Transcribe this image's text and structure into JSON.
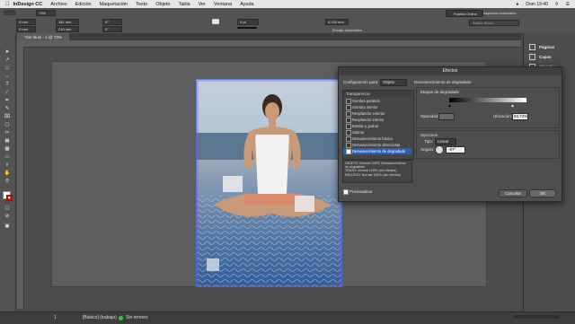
{
  "menubar": {
    "app": "InDesign CC",
    "items": [
      "Archivo",
      "Edición",
      "Maquetación",
      "Texto",
      "Objeto",
      "Tabla",
      "Ver",
      "Ventana",
      "Ayuda"
    ],
    "clock": "Dom 19:40"
  },
  "control": {
    "zoom": "73%",
    "x": "0 mm",
    "y": "0 mm",
    "w": "181 mm",
    "h": "210 mm",
    "rot": "0°",
    "shear": "0°",
    "stroke": "0 pt",
    "dim": "4,233 mm",
    "fit": "Encaje automático",
    "publish": "Publish Online",
    "workspace": "Aspectos esenciales",
    "search_placeholder": "Adobe Stock"
  },
  "document": {
    "tab": "*Sin título - 1 @ 73%"
  },
  "right_panel": {
    "items": [
      "Páginas",
      "Capas",
      "Vínculos"
    ]
  },
  "status": {
    "page": "1",
    "style": "[Básico] (trabajo)",
    "errors": "Sin errores"
  },
  "dialog": {
    "title": "Efectos",
    "config_label": "Configuración para:",
    "config_value": "Objeto",
    "section_title": "Desvanecimiento de degradado",
    "list_header": "Transparencia",
    "effects": [
      "Sombra paralela",
      "Sombra interior",
      "Resplandor exterior",
      "Resplandor interior",
      "Biselar y grabar",
      "Satinar",
      "Desvanecimiento básico",
      "Desvanecimiento direccional",
      "Desvanecimiento de degradado"
    ],
    "selected_effect": "Desvanecimiento de degradado",
    "summary": "OBJETO: Normal 100%; Desvanecimiento de degradado\nTRAZO: Normal 100%; (sin efectos)\nRELLENO: Normal 100%; (sin efectos)",
    "preview_label": "Previsualizar",
    "stops_label": "Etapas de degradado",
    "opacity_label": "Opacidad:",
    "opacity_value": "",
    "location_label": "Ubicación:",
    "location_value": "83,74%",
    "options_label": "Opciones",
    "type_label": "Tipo:",
    "type_value": "Lineal",
    "angle_label": "Ángulo:",
    "angle_value": "-87°",
    "cancel": "Cancelar",
    "ok": "OK"
  }
}
